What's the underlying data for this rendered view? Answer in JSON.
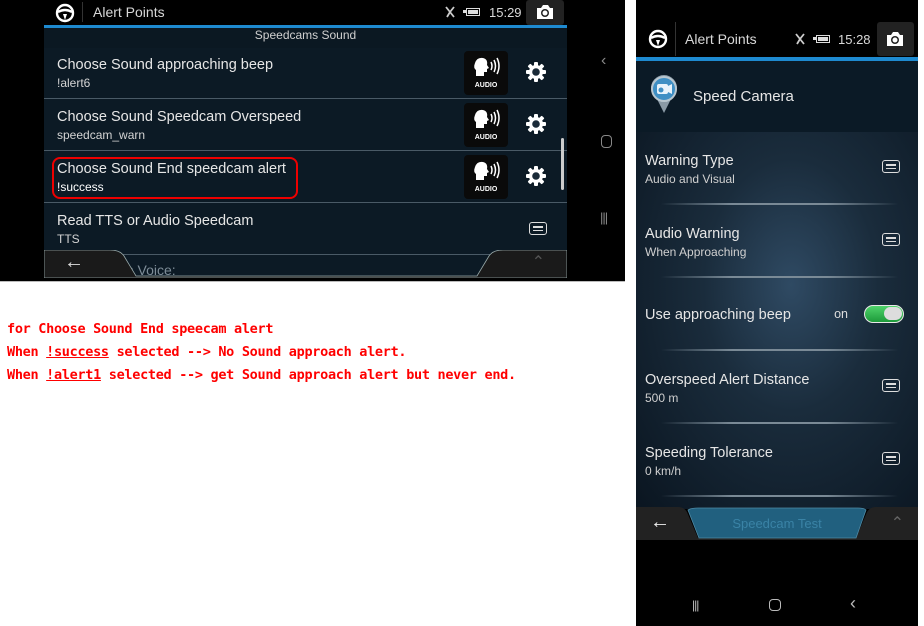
{
  "left_screen": {
    "status_bar": {
      "title": "Alert Points",
      "time": "15:29"
    },
    "subheader": "Speedcams Sound",
    "rows": [
      {
        "title": "Choose Sound approaching beep",
        "value": "!alert6",
        "action": "audio",
        "audio_label": "AUDIO"
      },
      {
        "title": "Choose Sound Speedcam Overspeed",
        "value": "speedcam_warn",
        "action": "audio",
        "audio_label": "AUDIO"
      },
      {
        "title": "Choose Sound End speedcam alert",
        "value": "!success",
        "action": "audio",
        "audio_label": "AUDIO",
        "highlighted": true
      },
      {
        "title": "Read TTS or Audio Speedcam",
        "value": "TTS",
        "action": "menu"
      }
    ],
    "partial_row_text": "m Voice:",
    "system_nav": [
      "back",
      "home",
      "recents"
    ]
  },
  "annotation": {
    "line1": "for Choose Sound End speecam alert",
    "line2_prefix": "When ",
    "line2_link": "!success",
    "line2_suffix": " selected --> No Sound approach alert.",
    "line3_prefix": "When ",
    "line3_link": "!alert1",
    "line3_suffix": " selected --> get Sound approach alert but never end.",
    "color": "#ff0000"
  },
  "right_screen": {
    "status_bar": {
      "title": "Alert Points",
      "time": "15:28"
    },
    "header": {
      "title": "Speed Camera"
    },
    "rows": [
      {
        "title": "Warning Type",
        "value": "Audio and Visual",
        "control": "menu"
      },
      {
        "title": "Audio Warning",
        "value": "When Approaching",
        "control": "menu"
      },
      {
        "title": "Use approaching beep",
        "control": "toggle",
        "toggle_label": "on",
        "toggle_on": true
      },
      {
        "title": "Overspeed Alert Distance",
        "value": "500 m",
        "control": "menu"
      },
      {
        "title": "Speeding Tolerance",
        "value": "0 km/h",
        "control": "menu"
      }
    ],
    "bottom_button": "Speedcam Test",
    "toggle_color": "#2fb84f"
  }
}
